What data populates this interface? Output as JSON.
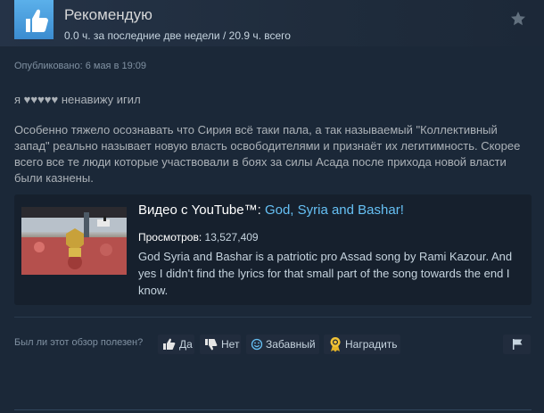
{
  "review": {
    "recommendation": "Рекомендую",
    "hours": "0.0 ч. за последние две недели / 20.9 ч. всего",
    "posted": "Опубликовано: 6 мая в 19:09",
    "paragraph1": "я ♥♥♥♥♥ ненавижу игил",
    "paragraph2": "Особенно тяжело осознавать что Сирия всё таки пала, а так называемый \"Коллективный запад\" реально называет новую власть освободителями и признаёт их легитимность. Скорее всего все те люди которые участвовали в боях за силы Асада после прихода новой власти были казнены."
  },
  "video": {
    "prefix": "Видео с YouTube™: ",
    "title": "God, Syria and Bashar!",
    "views_label": "Просмотров: ",
    "views": "13,527,409",
    "description": "God Syria and Bashar is a patriotic pro Assad song by Rami Kazour. And yes I didn't find the lyrics for that small part of the song towards the end I know."
  },
  "feedback": {
    "question": "Был ли этот обзор полезен?",
    "yes": "Да",
    "no": "Нет",
    "funny": "Забавный",
    "award": "Наградить"
  },
  "icons": {
    "recommend": "thumbs-up-icon",
    "favorite": "star-icon",
    "yes": "thumbs-up-icon",
    "no": "thumbs-down-icon",
    "funny": "smiley-icon",
    "award": "award-icon",
    "report": "flag-icon"
  },
  "colors": {
    "background": "#1b2838",
    "link": "#66c0f4",
    "recommend_badge": "#4c9fe0"
  }
}
